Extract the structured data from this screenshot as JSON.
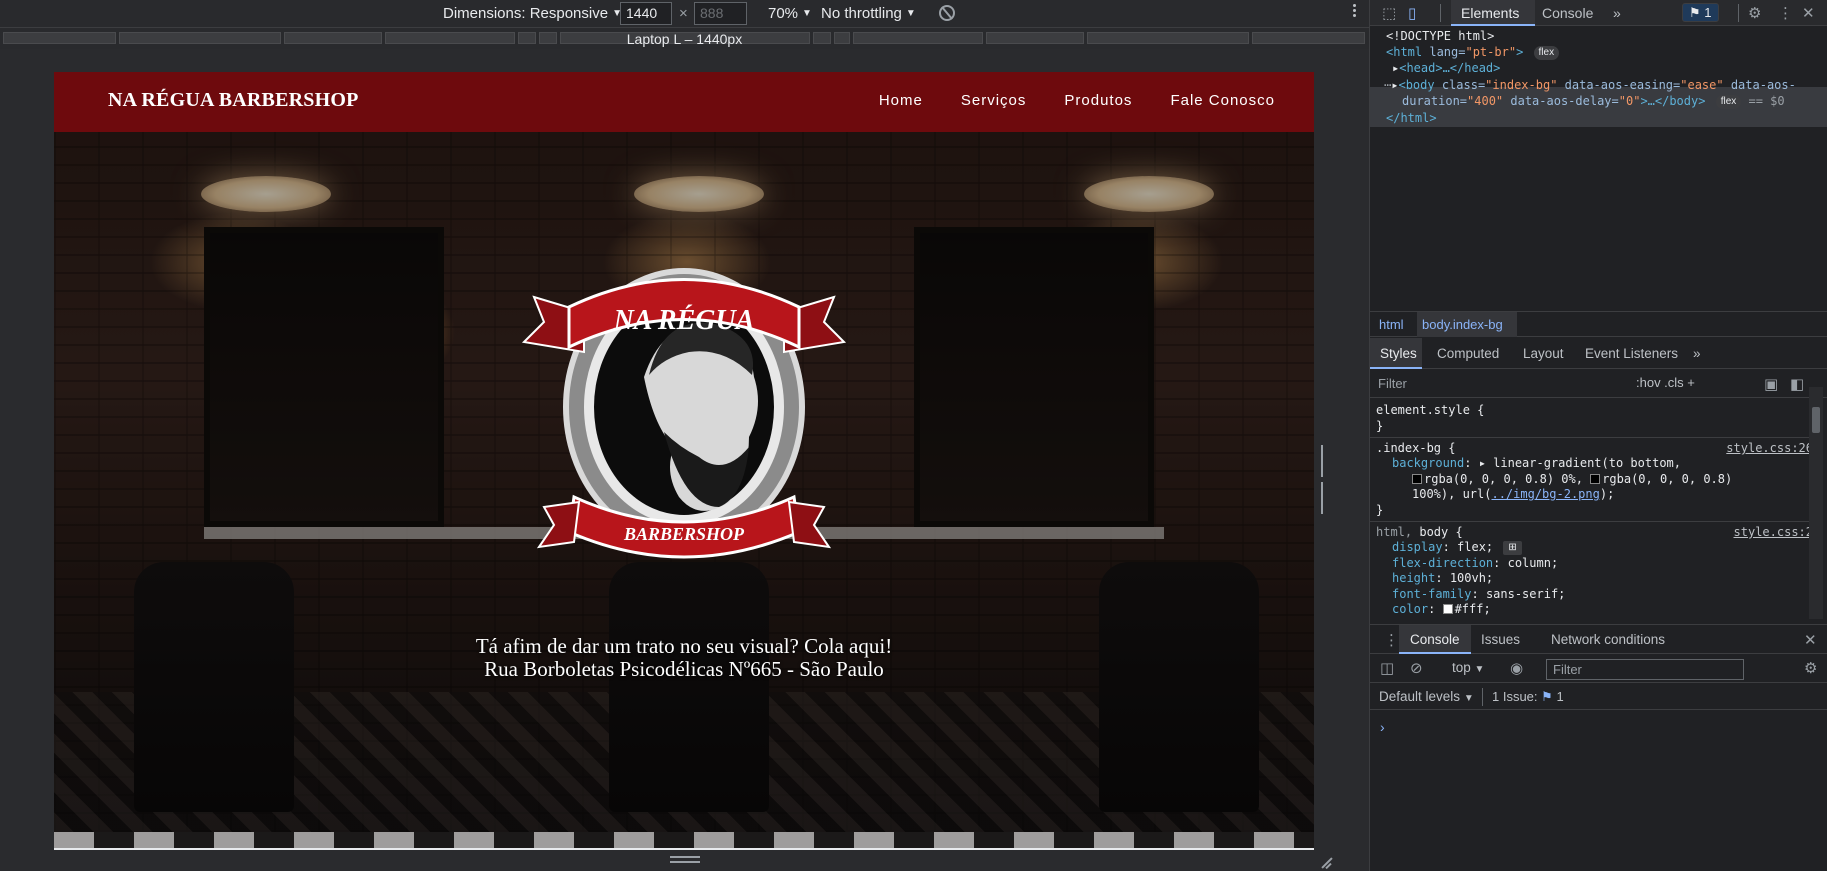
{
  "device_toolbar": {
    "dimensions_label": "Dimensions: Responsive",
    "width_value": "1440",
    "times_sign": "×",
    "height_placeholder": "888",
    "zoom": "70%",
    "throttling": "No throttling",
    "more_icon": "kebab-icon",
    "rotate_icon": "rotate-icon"
  },
  "media_query_bar": {
    "label": "Laptop L – 1440px"
  },
  "page": {
    "brand": "NA RÉGUA BARBERSHOP",
    "nav_links": [
      "Home",
      "Serviços",
      "Produtos",
      "Fale Conosco"
    ],
    "logo_top_text": "NA RÉGUA",
    "logo_bottom_text": "BARBERSHOP",
    "hero_line1": "Tá afim de dar um trato no seu visual? Cola aqui!",
    "hero_line2": "Rua Borboletas Psicodélicas Nº665 - São Paulo",
    "nav_color": "#6e0a0d"
  },
  "devtools": {
    "tabs": [
      "Elements",
      "Console"
    ],
    "more_tabs": "»",
    "issues_count": "1",
    "dom": {
      "doctype": "<!DOCTYPE html>",
      "html_open_tag": "<html",
      "html_attr_name": " lang=",
      "html_attr_value": "\"pt-br\"",
      "html_open_close": ">",
      "html_pill": "flex",
      "head": "<head>…</head>",
      "body_tag": "<body",
      "body_class_name": " class=",
      "body_class_value": "\"index-bg\"",
      "body_attr_easing": " data-aos-easing=",
      "body_attr_easing_value": "\"ease\"",
      "body_attr_duration_prefix": " data-aos-",
      "body_attr_duration_cont": "duration=",
      "body_attr_duration_value": "\"400\"",
      "body_attr_delay": " data-aos-delay=",
      "body_attr_delay_value": "\"0\"",
      "body_close": ">…</body>",
      "body_pill": "flex",
      "body_eq": "== $0",
      "html_close": "</html>"
    },
    "breadcrumbs": [
      "html",
      "body.index-bg"
    ],
    "style_tabs": [
      "Styles",
      "Computed",
      "Layout",
      "Event Listeners"
    ],
    "filter_placeholder": "Filter",
    "filter_tools": ":hov  .cls  +",
    "styles": {
      "element_style": "element.style {",
      "close_brace": "}",
      "rule1_selector": ".index-bg {",
      "rule1_source": "style.css:26",
      "rule1_prop": "background",
      "rule1_val1": "linear-gradient(to bottom,",
      "rule1_val2a": "rgba(0, 0, 0, 0.8) 0%,",
      "rule1_val2b": "rgba(0, 0, 0, 0.8)",
      "rule1_val3a": "100%), url(",
      "rule1_link": "../img/bg-2.png",
      "rule1_val3b": ");",
      "rule2_selector_a": "html,",
      "rule2_selector_b": " body {",
      "rule2_source": "style.css:2",
      "rule2_props": [
        {
          "name": "display",
          "value": "flex;"
        },
        {
          "name": "flex-direction",
          "value": "column;"
        },
        {
          "name": "height",
          "value": "100vh;"
        },
        {
          "name": "font-family",
          "value": "sans-serif;"
        },
        {
          "name": "color",
          "value": "#fff;"
        }
      ]
    },
    "drawer_tabs": [
      "Console",
      "Issues",
      "Network conditions"
    ],
    "console_context": "top",
    "console_filter_placeholder": "Filter",
    "default_levels": "Default levels",
    "issue_button": "1 Issue:",
    "issue_button_count": "1",
    "prompt": "›"
  }
}
